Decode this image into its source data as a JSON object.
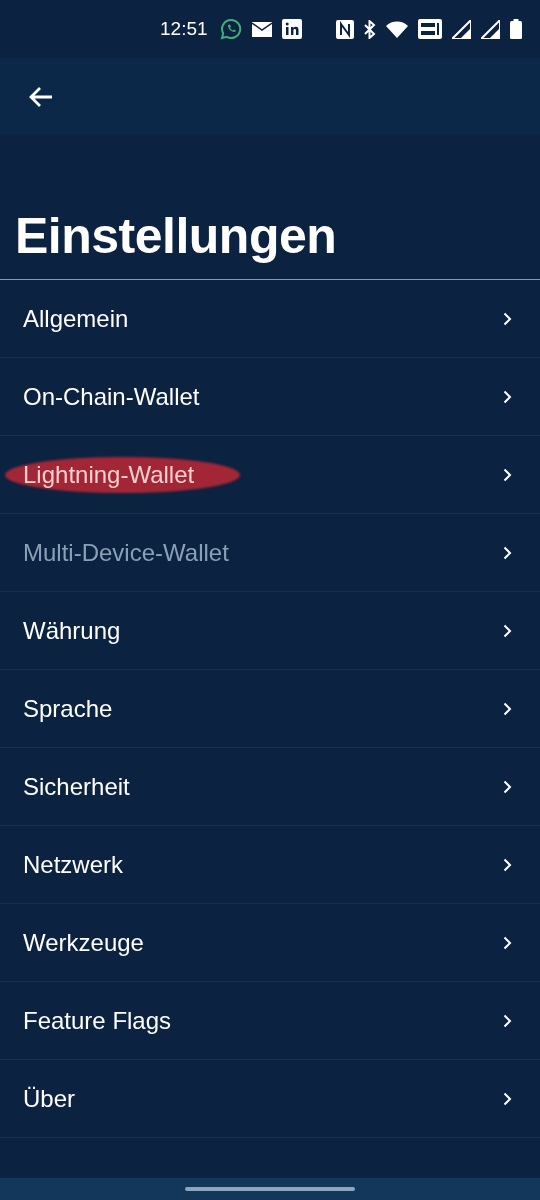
{
  "status_bar": {
    "time": "12:51"
  },
  "title": "Einstellungen",
  "items": [
    {
      "label": "Allgemein",
      "disabled": false,
      "highlighted": false
    },
    {
      "label": "On-Chain-Wallet",
      "disabled": false,
      "highlighted": false
    },
    {
      "label": "Lightning-Wallet",
      "disabled": false,
      "highlighted": true
    },
    {
      "label": "Multi-Device-Wallet",
      "disabled": true,
      "highlighted": false
    },
    {
      "label": "Währung",
      "disabled": false,
      "highlighted": false
    },
    {
      "label": "Sprache",
      "disabled": false,
      "highlighted": false
    },
    {
      "label": "Sicherheit",
      "disabled": false,
      "highlighted": false
    },
    {
      "label": "Netzwerk",
      "disabled": false,
      "highlighted": false
    },
    {
      "label": "Werkzeuge",
      "disabled": false,
      "highlighted": false
    },
    {
      "label": "Feature Flags",
      "disabled": false,
      "highlighted": false
    },
    {
      "label": "Über",
      "disabled": false,
      "highlighted": false
    }
  ]
}
